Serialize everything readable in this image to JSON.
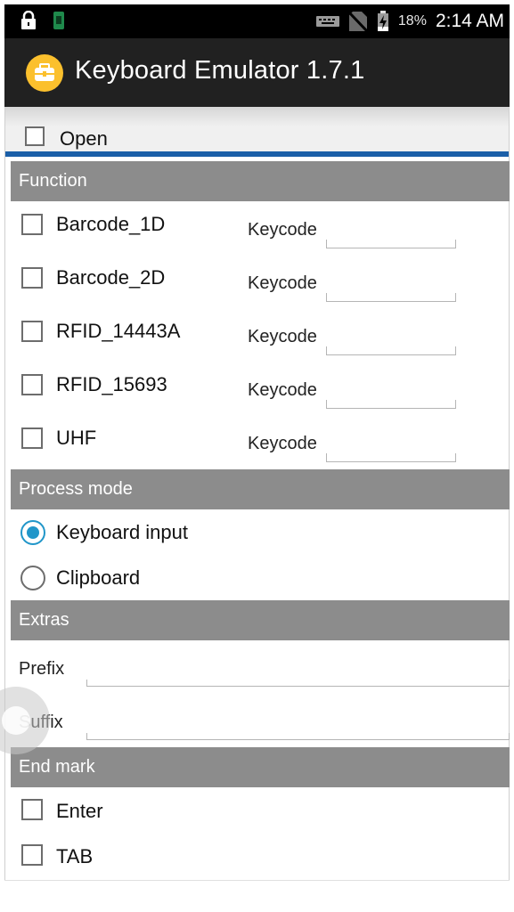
{
  "status_bar": {
    "battery": "18%",
    "time": "2:14 AM",
    "icons": [
      "lock-icon",
      "notification-app-icon",
      "keyboard-icon",
      "no-sim-icon",
      "battery-charging-icon"
    ]
  },
  "app_bar": {
    "title": "Keyboard Emulator  1.7.1",
    "logo_icon": "toolbox-icon",
    "logo_color": "#fbc02d"
  },
  "open": {
    "label": "Open",
    "checked": false
  },
  "function": {
    "header": "Function",
    "items": [
      {
        "label": "Barcode_1D",
        "checked": false,
        "keycode_label": "Keycode",
        "keycode_value": ""
      },
      {
        "label": "Barcode_2D",
        "checked": false,
        "keycode_label": "Keycode",
        "keycode_value": ""
      },
      {
        "label": "RFID_14443A",
        "checked": false,
        "keycode_label": "Keycode",
        "keycode_value": ""
      },
      {
        "label": "RFID_15693",
        "checked": false,
        "keycode_label": "Keycode",
        "keycode_value": ""
      },
      {
        "label": "UHF",
        "checked": false,
        "keycode_label": "Keycode",
        "keycode_value": ""
      }
    ]
  },
  "process_mode": {
    "header": "Process mode",
    "options": [
      {
        "label": "Keyboard input",
        "selected": true
      },
      {
        "label": "Clipboard",
        "selected": false
      }
    ]
  },
  "extras": {
    "header": "Extras",
    "prefix_label": "Prefix",
    "prefix_value": "",
    "suffix_label": "Suffix",
    "suffix_value": ""
  },
  "end_mark": {
    "header": "End mark",
    "items": [
      {
        "label": "Enter",
        "checked": false
      },
      {
        "label": "TAB",
        "checked": false
      }
    ]
  },
  "colors": {
    "accent": "#2196c9",
    "section_header": "#8c8c8c",
    "divider_blue": "#1b5fa8",
    "app_bar": "#212121"
  }
}
